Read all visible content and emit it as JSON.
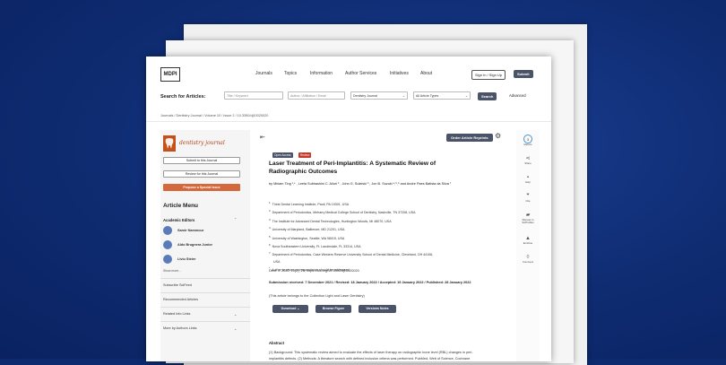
{
  "header": {
    "logo": "MDPI",
    "nav": [
      "Journals",
      "Topics",
      "Information",
      "Author Services",
      "Initiatives",
      "About"
    ],
    "signin": "Sign In / Sign Up",
    "submit": "Submit"
  },
  "search": {
    "label": "Search for Articles:",
    "title_placeholder": "Title / Keyword",
    "author_placeholder": "Author / Affiliation / Email",
    "journal": "Dentistry Journal",
    "article_type": "All Article Types",
    "search_btn": "Search",
    "advanced": "Advanced"
  },
  "breadcrumb": "Journals  /  Dentistry Journal  /  Volume 10  /  Issue 2  /  10.3390/dj10020020",
  "sidebar": {
    "journal_name": "dentistry journal",
    "submit_btn": "Submit to this Journal",
    "review_btn": "Review for this Journal",
    "propose_btn": "Propose a Special Issue",
    "menu_title": "Article Menu",
    "editors_title": "Academic Editors",
    "editors": [
      "Samir Nammour",
      "Aldo Brugnera Junior",
      "Liviu Steier"
    ],
    "show_more": "Show more...",
    "links": [
      "Subscribe SciFeed",
      "Recommended Articles",
      "Related Info Links",
      "More by Authors Links"
    ]
  },
  "article": {
    "badge_open": "Open Access",
    "badge_review": "Review",
    "reprints": "Order Article Reprints",
    "title": "Laser Treatment of Peri-Implantitis: A Systematic Review of Radiographic Outcomes",
    "authors": "by Miriam Ting ¹,* , Leela Subhashini C. Alluri ² , John G. Suleiski ³ , Jon B. Suzuki ⁴,⁵,⁶  and Andre Paes Batista da Silva ⁷",
    "affiliations": [
      {
        "n": "1",
        "text": "Think Dental Learning Institute, Paoli, PA 19301, USA"
      },
      {
        "n": "2",
        "text": "Department of Periodontics, Meharry Medical College School of Dentistry, Nashville, TN 37208, USA"
      },
      {
        "n": "3",
        "text": "The Institute for Advanced Dental Technologies, Huntington Woods, MI 48070, USA"
      },
      {
        "n": "4",
        "text": "University of Maryland, Baltimore, MD 21201, USA"
      },
      {
        "n": "5",
        "text": "University of Washington, Seattle, WA 98015, USA"
      },
      {
        "n": "6",
        "text": "Nova Southeastern University, Ft. Lauderdale, FL 33314, USA"
      },
      {
        "n": "7",
        "text": "Department of Periodontics, Case Western Reserve University School of Dental Medicine, Cleveland, OH 44106,"
      },
      {
        "n": "",
        "text": "USA"
      },
      {
        "n": "*",
        "text": "Author to whom correspondence should be addressed."
      }
    ],
    "citation": "Dent. J. 2022, 10(2), 20; https://doi.org/10.3390/dj10020020",
    "dates": "Submission received: 7 December 2021 / Revised: 18 January 2022 / Accepted: 19 January 2022 / Published: 28 January 2022",
    "belongs": "(This article belongs to the Collection Light and Laser Dentistry)",
    "download": "Download ⌄",
    "browse": "Browse Figure",
    "versions": "Versions Notes",
    "abstract_heading": "Abstract",
    "abstract": "(1) Background: This systematic review aimed to evaluate the effects of laser therapy on radiographic bone level (RBL) changes in peri-implantitis defects. (2) Methods: A literature search with defined inclusion criteria was performed. PubMed, Web of Science, Cochrane Library, and Google Scholar were searched through September"
  },
  "rightbar": {
    "metrics_value": "3",
    "items": [
      "Metrics",
      "Share",
      "Help",
      "Cite",
      "Discuss in SciProfiles",
      "Endorse",
      "Comment"
    ]
  },
  "colors": {
    "background": "#0f2c72",
    "button_dark": "#4a5368",
    "propose_orange": "#d3683d",
    "badge_open": "#4a5368",
    "badge_review": "#c0392b"
  }
}
